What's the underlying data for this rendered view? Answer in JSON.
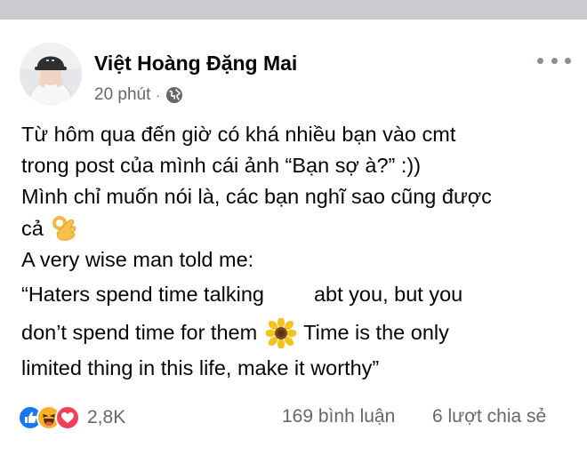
{
  "post": {
    "author": "Việt Hoàng Đặng Mai",
    "timestamp": "20 phút",
    "separator": "·",
    "audience_icon": "globe-icon",
    "more_icon": "more-options-icon",
    "lines": [
      "Từ hôm qua đến giờ có khá nhiều bạn vào cmt",
      "trong post của mình cái ảnh  “Bạn sợ à?” :))",
      "Mình chỉ muốn nói là, các bạn nghĩ sao cũng được",
      "cả",
      "A very wise man told me:",
      "“Haters spend time talking",
      "abt you, but you",
      "don’t spend time for them",
      "Time is the only",
      "limited thing in this life, make it worthy”"
    ],
    "emojis": [
      "ok-hand-icon",
      "sunflower-icon"
    ]
  },
  "footer": {
    "reaction_icons": [
      "like-icon",
      "haha-icon",
      "love-icon"
    ],
    "reaction_count": "2,8K",
    "comments": "169 bình luận",
    "shares": "6 lượt chia sẻ"
  },
  "colors": {
    "background": "#ffffff",
    "top_strip": "#c9cbcf",
    "text_primary": "#050505",
    "text_secondary": "#65676b",
    "like_blue": "#1877f2",
    "love_red": "#f33e58",
    "haha_yellow": "#f7b125"
  }
}
